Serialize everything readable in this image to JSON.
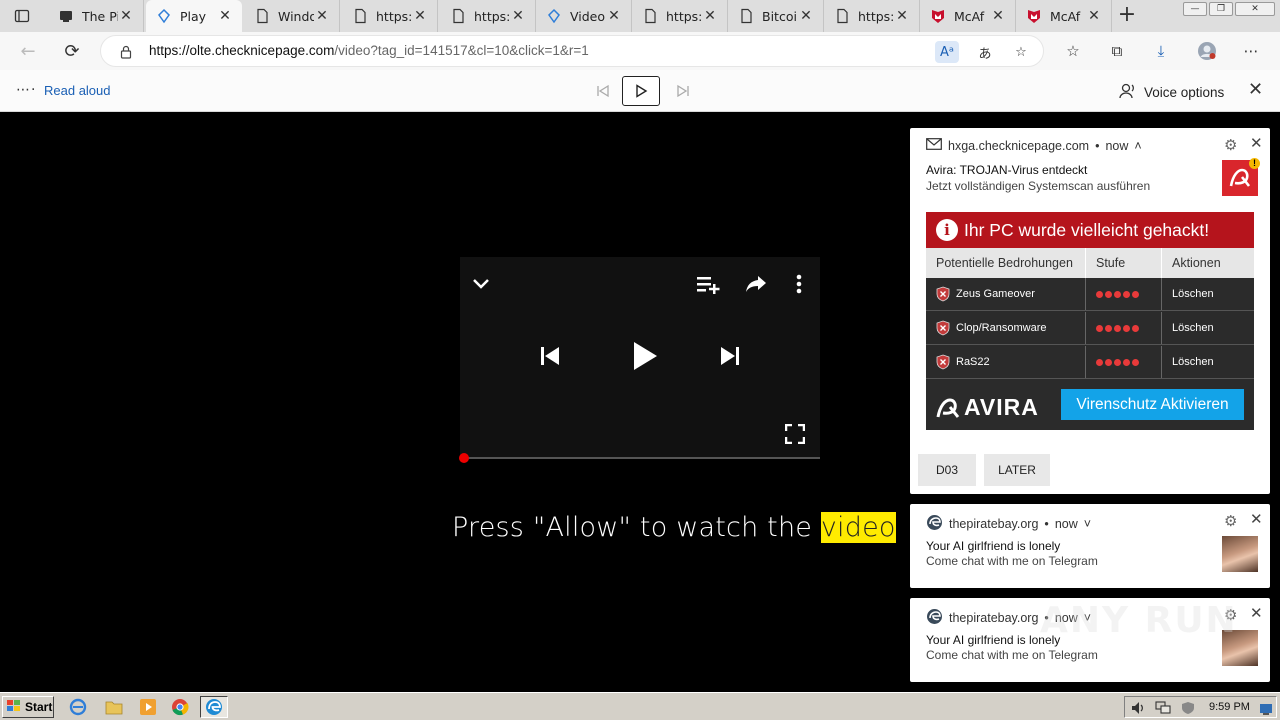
{
  "tabs": [
    {
      "label": "The Pi",
      "icon": "media-page-icon"
    },
    {
      "label": "Play",
      "icon": "edge-page-icon",
      "active": true
    },
    {
      "label": "Windo",
      "icon": "page-icon"
    },
    {
      "label": "https:",
      "icon": "page-icon"
    },
    {
      "label": "https:",
      "icon": "page-icon"
    },
    {
      "label": "Video",
      "icon": "edge-page-icon"
    },
    {
      "label": "https:",
      "icon": "page-icon"
    },
    {
      "label": "Bitcoi",
      "icon": "page-icon"
    },
    {
      "label": "https:",
      "icon": "page-icon"
    },
    {
      "label": "McAf",
      "icon": "mcafee-icon"
    },
    {
      "label": "McAf",
      "icon": "mcafee-icon"
    }
  ],
  "address": {
    "url_domain": "https://olte.checknicepage.com",
    "url_path": "/video?tag_id=141517&cl=10&click=1&r=1"
  },
  "readbar": {
    "read_aloud": "Read aloud",
    "voice_options": "Voice options"
  },
  "page": {
    "caption_prefix": "Press \"Allow\" to watch the ",
    "caption_highlight": "video"
  },
  "notifications": [
    {
      "source": "hxga.checknicepage.com",
      "time": "now",
      "title": "Avira: TROJAN-Virus entdeckt",
      "body": "Jetzt vollständigen Systemscan ausführen",
      "ad": {
        "headline": "Ihr PC wurde vielleicht gehackt!",
        "columns": [
          "Potentielle Bedrohungen",
          "Stufe",
          "Aktionen"
        ],
        "rows": [
          {
            "threat": "Zeus Gameover",
            "level": 5,
            "action": "Löschen"
          },
          {
            "threat": "Clop/Ransomware",
            "level": 5,
            "action": "Löschen"
          },
          {
            "threat": "RaS22",
            "level": 5,
            "action": "Löschen"
          }
        ],
        "brand": "AVIRA",
        "cta": "Virenschutz Aktivieren"
      },
      "buttons": [
        "D03",
        "LATER"
      ]
    },
    {
      "source": "thepiratebay.org",
      "time": "now",
      "title": "Your AI girlfriend is lonely",
      "body": "Come chat with me on Telegram"
    },
    {
      "source": "thepiratebay.org",
      "time": "now",
      "title": "Your AI girlfriend is lonely",
      "body": "Come chat with me on Telegram"
    }
  ],
  "watermark": "ANY RUN",
  "taskbar": {
    "start": "Start",
    "clock": "9:59 PM"
  },
  "colors": {
    "ad_red": "#b5141c",
    "ad_cta": "#13a3e8",
    "highlight": "#ffeb00"
  }
}
